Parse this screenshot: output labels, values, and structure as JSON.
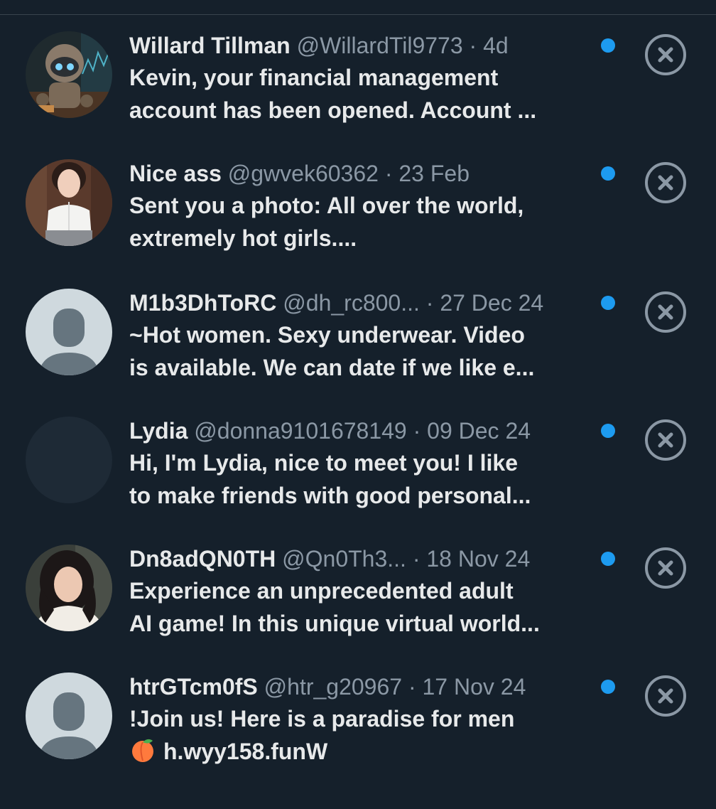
{
  "colors": {
    "background": "#15202b",
    "unread_dot": "#1d9bf0",
    "muted_text": "#8b98a5",
    "primary_text": "#e7e9ea"
  },
  "requests": [
    {
      "name": "Willard Tillman",
      "handle": "@WillardTil9773",
      "separator": " · ",
      "date": "4d",
      "line1": "Kevin, your financial management",
      "line2": "account has been opened. Account ...",
      "avatar": "robot-photo"
    },
    {
      "name": "Nice ass",
      "handle": "@gwvek60362",
      "separator": " · ",
      "date": "23 Feb",
      "line1": "Sent you a photo: All over the world,",
      "line2": "extremely hot girls....",
      "avatar": "woman-photo"
    },
    {
      "name": "M1b3DhToRC",
      "handle": "@dh_rc800...",
      "separator": " · ",
      "date": "27 Dec 24",
      "line1": "~Hot women. Sexy underwear. Video",
      "line2": "is available. We can date if we like e...",
      "avatar": "default-avatar"
    },
    {
      "name": "Lydia",
      "handle": "@donna9101678149",
      "separator": " · ",
      "date": "09 Dec 24",
      "line1": "Hi, I'm Lydia, nice to meet you! I like",
      "line2": "to make friends with good personal...",
      "avatar": "blank-avatar"
    },
    {
      "name": "Dn8adQN0TH",
      "handle": "@Qn0Th3...",
      "separator": " · ",
      "date": "18 Nov 24",
      "line1": "Experience an unprecedented adult",
      "line2": "AI game! In this unique virtual world...",
      "avatar": "girl-photo"
    },
    {
      "name": "htrGTcm0fS",
      "handle": "@htr_g20967",
      "separator": " · ",
      "date": "17 Nov 24",
      "line1": "!Join us! Here is a paradise for men",
      "line2": "h.wyy158.funW",
      "line2_emoji": "peach-emoji",
      "avatar": "default-avatar"
    }
  ]
}
